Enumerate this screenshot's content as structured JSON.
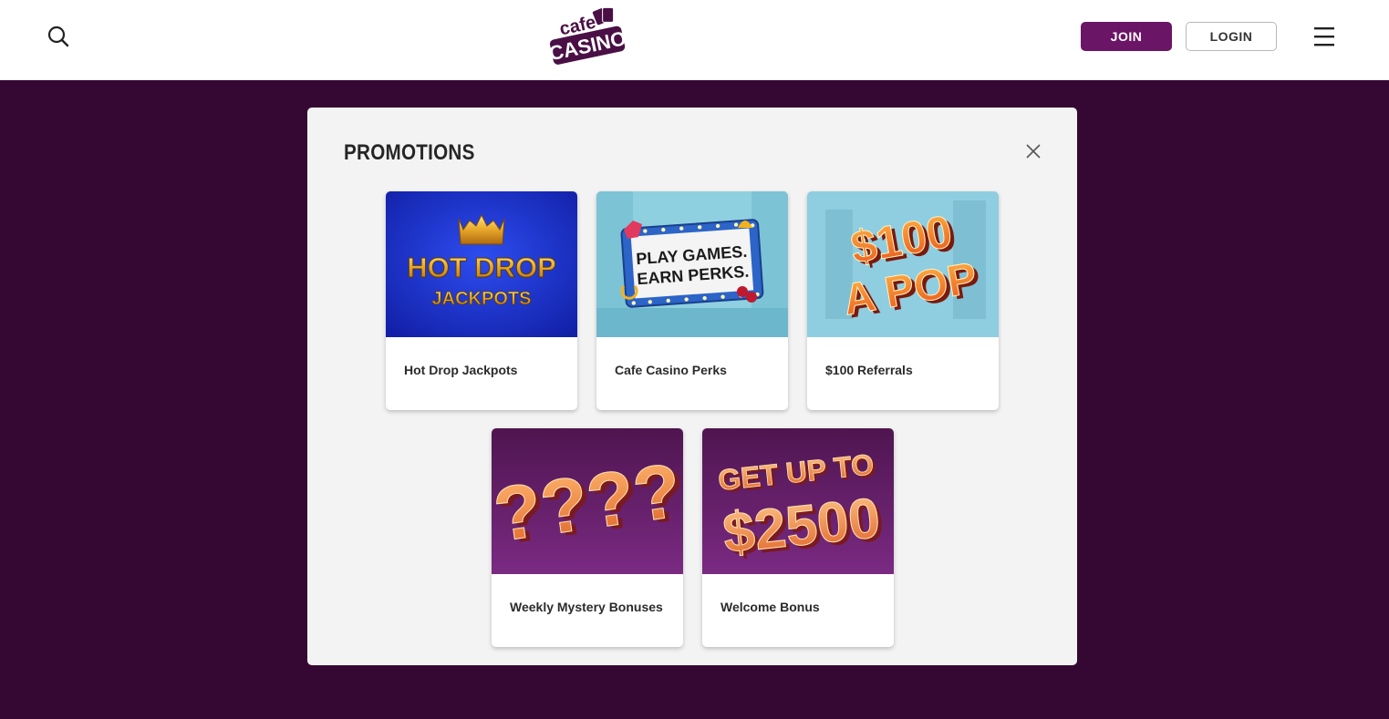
{
  "header": {
    "logo_text_top": "cafe",
    "logo_text_bottom": "CASINO",
    "join_label": "JOIN",
    "login_label": "LOGIN",
    "search_icon": "search-icon",
    "menu_icon": "hamburger-menu-icon"
  },
  "modal": {
    "title": "PROMOTIONS",
    "close_icon": "close-icon"
  },
  "promotions": [
    {
      "label": "Hot Drop Jackpots",
      "art_line1": "HOT DROP",
      "art_line2": "JACKPOTS"
    },
    {
      "label": "Cafe Casino Perks",
      "art_line1": "PLAY GAMES.",
      "art_line2": "EARN PERKS."
    },
    {
      "label": "$100 Referrals",
      "art_line1": "$100",
      "art_line2": "A POP"
    },
    {
      "label": "Weekly Mystery Bonuses",
      "art_line1": "????"
    },
    {
      "label": "Welcome Bonus",
      "art_line1": "GET UP TO",
      "art_line2": "$2500"
    }
  ],
  "colors": {
    "page_background": "#350833",
    "join_button": "#6b1566",
    "modal_background": "#f3f3f3",
    "logo_purple": "#4a1046"
  }
}
